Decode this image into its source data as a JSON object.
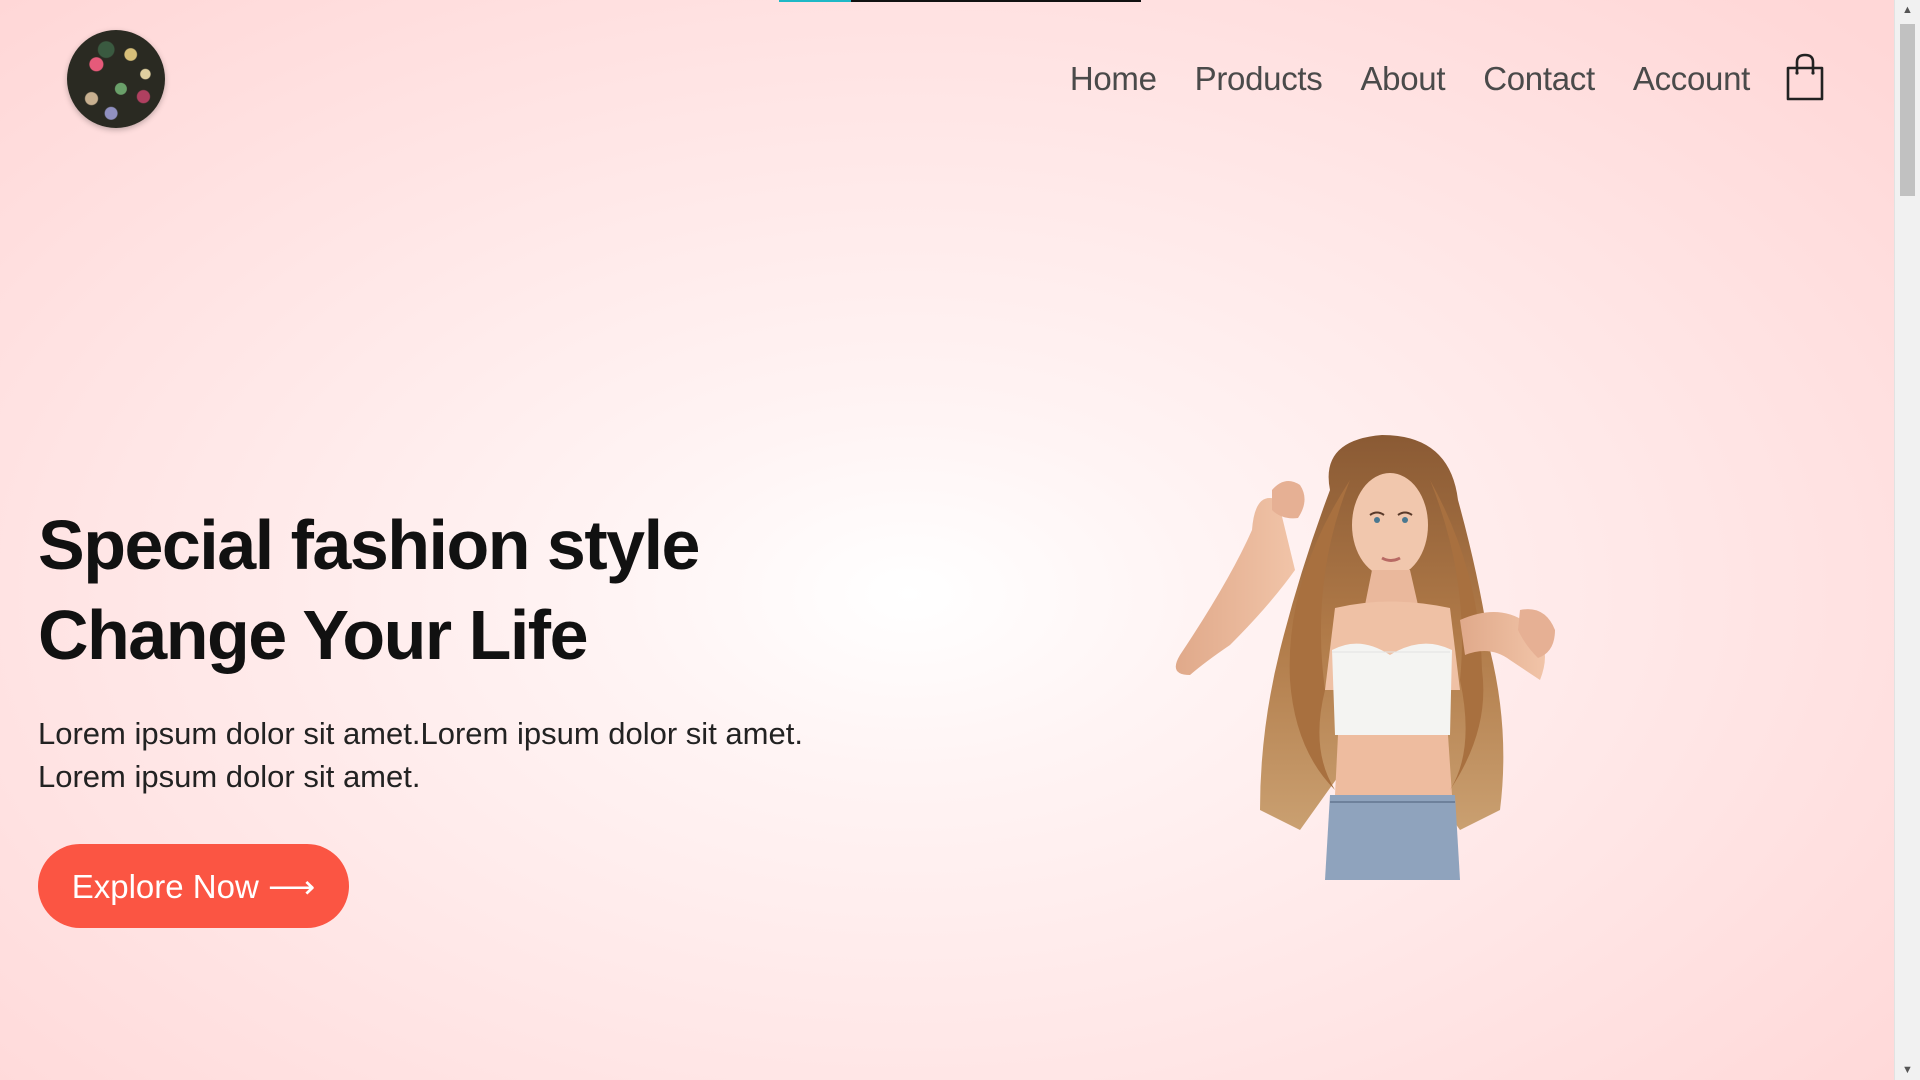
{
  "header": {
    "logo_alt": "buttons logo",
    "nav": [
      "Home",
      "Products",
      "About",
      "Contact",
      "Account"
    ],
    "cart_icon": "shopping-bag-icon"
  },
  "hero": {
    "title_line1": "Special fashion style",
    "title_line2": "Change Your Life",
    "text_line1": "Lorem ipsum dolor sit amet.Lorem ipsum dolor sit amet.",
    "text_line2": "Lorem ipsum dolor sit amet.",
    "cta_label": "Explore Now ⟶",
    "image_subject": "woman with long wavy hair"
  },
  "colors": {
    "accent": "#fb5543",
    "background": "#ffe4e4",
    "progress": "#1fb8c6"
  },
  "scroll_progress": 0.2
}
